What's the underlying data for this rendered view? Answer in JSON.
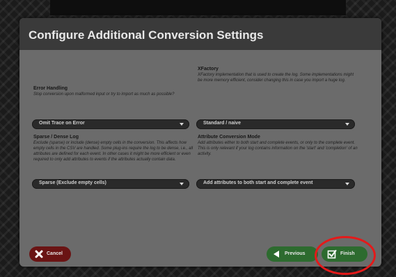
{
  "dialog": {
    "title": "Configure Additional Conversion Settings"
  },
  "settings": {
    "error_handling": {
      "label": "Error Handling",
      "description": "Stop conversion upon malformed input or try to import as much as possible?",
      "value": "Omit Trace on Error"
    },
    "xfactory": {
      "label": "XFactory",
      "description": "XFactory implementation that is used to create the log. Some implementations might be more memory efficient, consider changing this in case you import a huge log.",
      "value": "Standard / naive"
    },
    "sparse_dense": {
      "label": "Sparse / Dense Log",
      "description": "Exclude (sparse) or include (dense) empty cells in the conversion. This affects how empty cells in the CSV are handled. Some plug-ins require the log to be dense, i.e., all attributes are defined for each event. In other cases it might be more efficient or even required to only add attributes to events if the attributes actually contain data.",
      "value": "Sparse (Exclude empty cells)"
    },
    "attribute_mode": {
      "label": "Attribute Conversion Mode",
      "description": "Add attributes either to both start and complete events, or only to the complete event. This is only relevant if your log contains information on the 'start' and 'completion' of an activity.",
      "value": "Add attributes to both start and complete event"
    }
  },
  "buttons": {
    "cancel": "Cancel",
    "previous": "Previous",
    "finish": "Finish"
  },
  "icons": {
    "cancel": "close-icon",
    "previous": "arrow-left-icon",
    "finish": "checkbox-icon",
    "dropdown": "chevron-down-icon"
  },
  "colors": {
    "cancel_button": "#6a1414",
    "nav_button": "#2d6b2f",
    "highlight": "#e41a1a"
  }
}
